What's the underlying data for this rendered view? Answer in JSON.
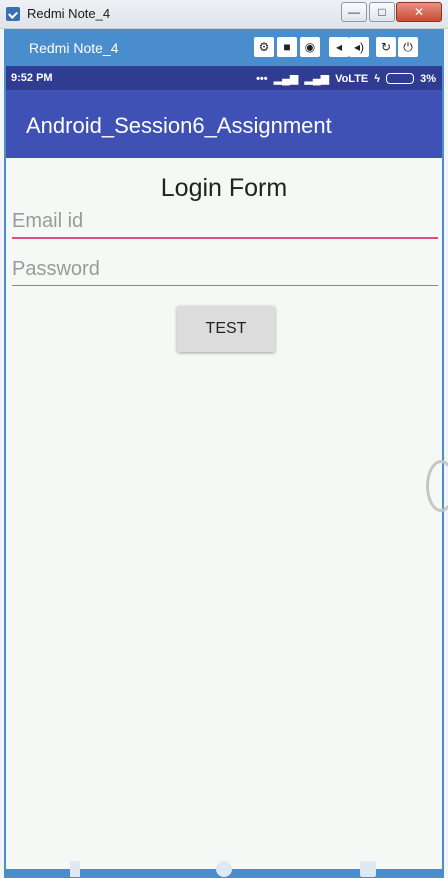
{
  "window": {
    "title": "Redmi Note_4",
    "buttons": {
      "minimize": "—",
      "maximize": "□",
      "close": "✕"
    }
  },
  "device_toolbar": {
    "device_name": "Redmi Note_4",
    "tools": [
      {
        "icon": "gear-icon",
        "glyph": "⚙"
      },
      {
        "icon": "video-icon",
        "glyph": "■"
      },
      {
        "icon": "camera-icon",
        "glyph": "◉"
      },
      {
        "icon": "volume-down-icon",
        "glyph": "◂"
      },
      {
        "icon": "volume-up-icon",
        "glyph": "◂)"
      },
      {
        "icon": "rotate-icon",
        "glyph": "↻"
      },
      {
        "icon": "power-icon",
        "glyph": "⏻"
      }
    ]
  },
  "status_bar": {
    "time": "9:52 PM",
    "network": "VoLTE",
    "battery": "3%"
  },
  "app_bar": {
    "title": "Android_Session6_Assignment"
  },
  "form": {
    "title": "Login Form",
    "email_placeholder": "Email id",
    "password_placeholder": "Password",
    "button_label": "TEST"
  },
  "colors": {
    "app_bar": "#3f51b5",
    "status_bar": "#2f3c92",
    "accent": "#e54887",
    "device_frame": "#4a8dcc"
  }
}
